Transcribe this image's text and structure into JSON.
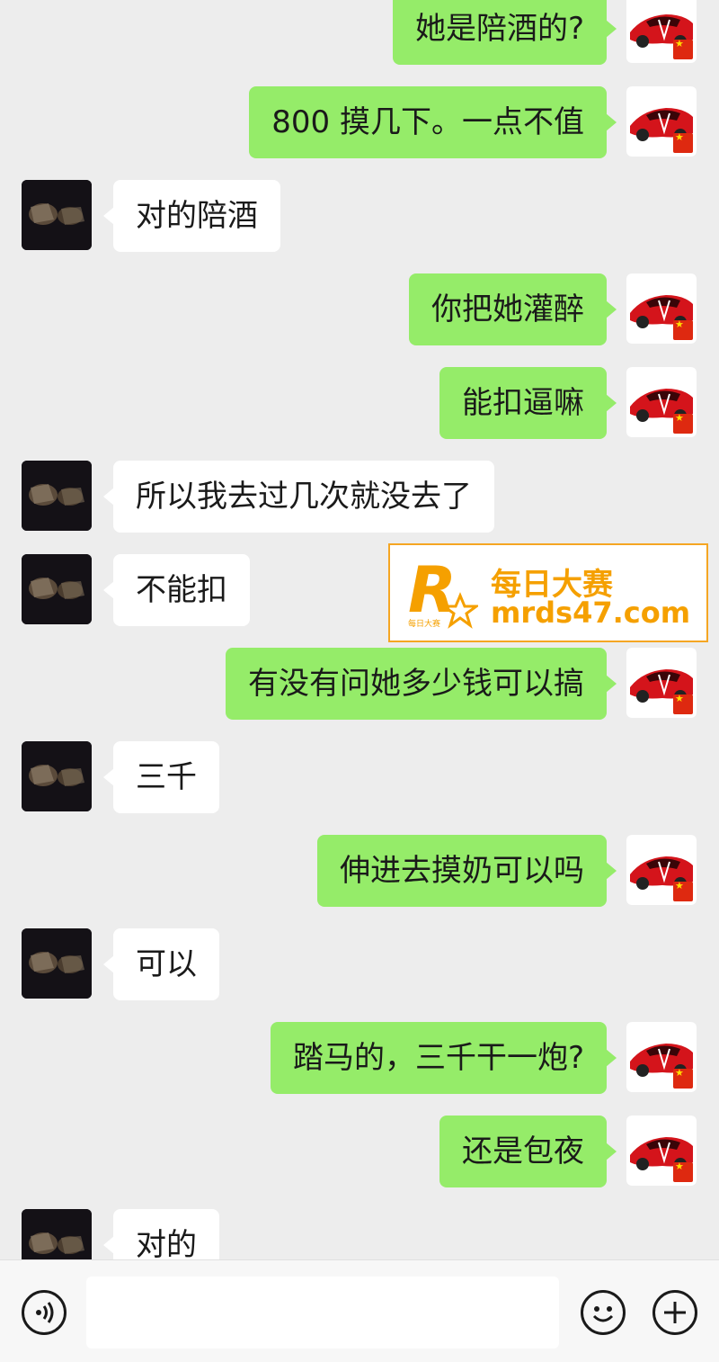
{
  "messages": [
    {
      "side": "me",
      "text": "她是陪酒的?"
    },
    {
      "side": "me",
      "text": "800 摸几下。一点不值"
    },
    {
      "side": "them",
      "text": "对的陪酒"
    },
    {
      "side": "me",
      "text": "你把她灌醉"
    },
    {
      "side": "me",
      "text": "能扣逼嘛"
    },
    {
      "side": "them",
      "text": "所以我去过几次就没去了"
    },
    {
      "side": "them",
      "text": "不能扣"
    },
    {
      "side": "me",
      "text": "有没有问她多少钱可以搞"
    },
    {
      "side": "them",
      "text": "三千"
    },
    {
      "side": "me",
      "text": "伸进去摸奶可以吗"
    },
    {
      "side": "them",
      "text": "可以"
    },
    {
      "side": "me",
      "text": "踏马的，三千干一炮?"
    },
    {
      "side": "me",
      "text": "还是包夜"
    },
    {
      "side": "them",
      "text": "对的"
    }
  ],
  "watermark": {
    "logo_letter": "R",
    "logo_small_text": "每日大赛",
    "title": "每日大赛",
    "url": "mrds47.com"
  },
  "input_bar": {
    "voice_icon": "voice-icon",
    "emoji_icon": "emoji-icon",
    "add_icon": "plus-icon",
    "input_value": ""
  },
  "colors": {
    "background": "#ededed",
    "bubble_me": "#95ec69",
    "bubble_them": "#ffffff",
    "watermark_accent": "#f5a000"
  }
}
